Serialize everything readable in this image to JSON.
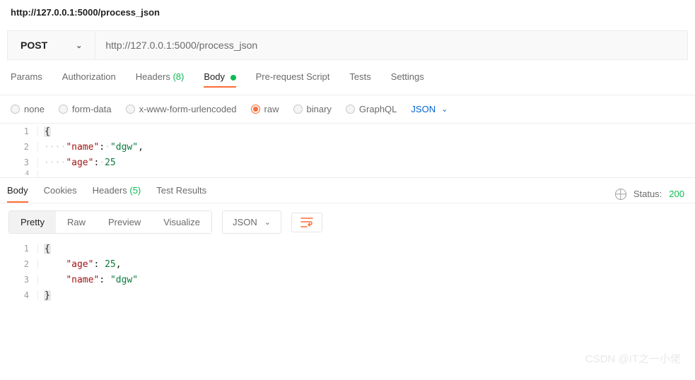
{
  "title": "http://127.0.0.1:5000/process_json",
  "request": {
    "method": "POST",
    "url": "http://127.0.0.1:5000/process_json"
  },
  "tabs": {
    "params": "Params",
    "auth": "Authorization",
    "headers_label": "Headers",
    "headers_count": "(8)",
    "body": "Body",
    "prerequest": "Pre-request Script",
    "tests": "Tests",
    "settings": "Settings"
  },
  "body_options": {
    "none": "none",
    "formdata": "form-data",
    "urlencoded": "x-www-form-urlencoded",
    "raw": "raw",
    "binary": "binary",
    "graphql": "GraphQL",
    "format": "JSON"
  },
  "request_body": {
    "line1": "{",
    "line2_key": "\"name\"",
    "line2_val": "\"dgw\"",
    "line3_key": "\"age\"",
    "line3_val": "25"
  },
  "response_tabs": {
    "body": "Body",
    "cookies": "Cookies",
    "headers_label": "Headers",
    "headers_count": "(5)",
    "test_results": "Test Results"
  },
  "status": {
    "label": "Status:",
    "code": "200"
  },
  "resp_toolbar": {
    "pretty": "Pretty",
    "raw": "Raw",
    "preview": "Preview",
    "visualize": "Visualize",
    "format": "JSON"
  },
  "response_body": {
    "line1": "{",
    "line2_key": "\"age\"",
    "line2_val": "25",
    "line3_key": "\"name\"",
    "line3_val": "\"dgw\"",
    "line4": "}"
  },
  "watermark": "CSDN @IT之一小佬"
}
